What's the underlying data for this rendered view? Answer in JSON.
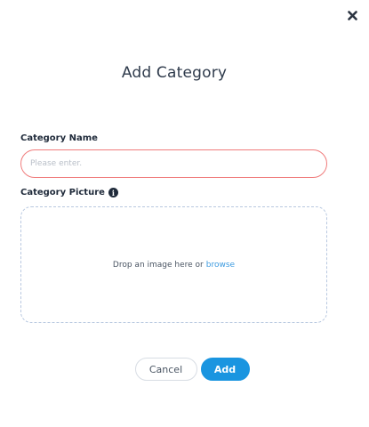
{
  "dialog": {
    "title": "Add Category",
    "close_icon": "close-icon"
  },
  "form": {
    "name_label": "Category Name",
    "name_placeholder": "Please enter.",
    "name_value": "",
    "picture_label": "Category Picture",
    "picture_info_icon": "info-circle-icon",
    "dropzone_text": "Drop an image here or",
    "dropzone_link": "browse"
  },
  "actions": {
    "cancel_label": "Cancel",
    "add_label": "Add"
  },
  "colors": {
    "accent": "#1a95e0",
    "error_border": "#f07b7b",
    "link": "#3d9be0"
  }
}
